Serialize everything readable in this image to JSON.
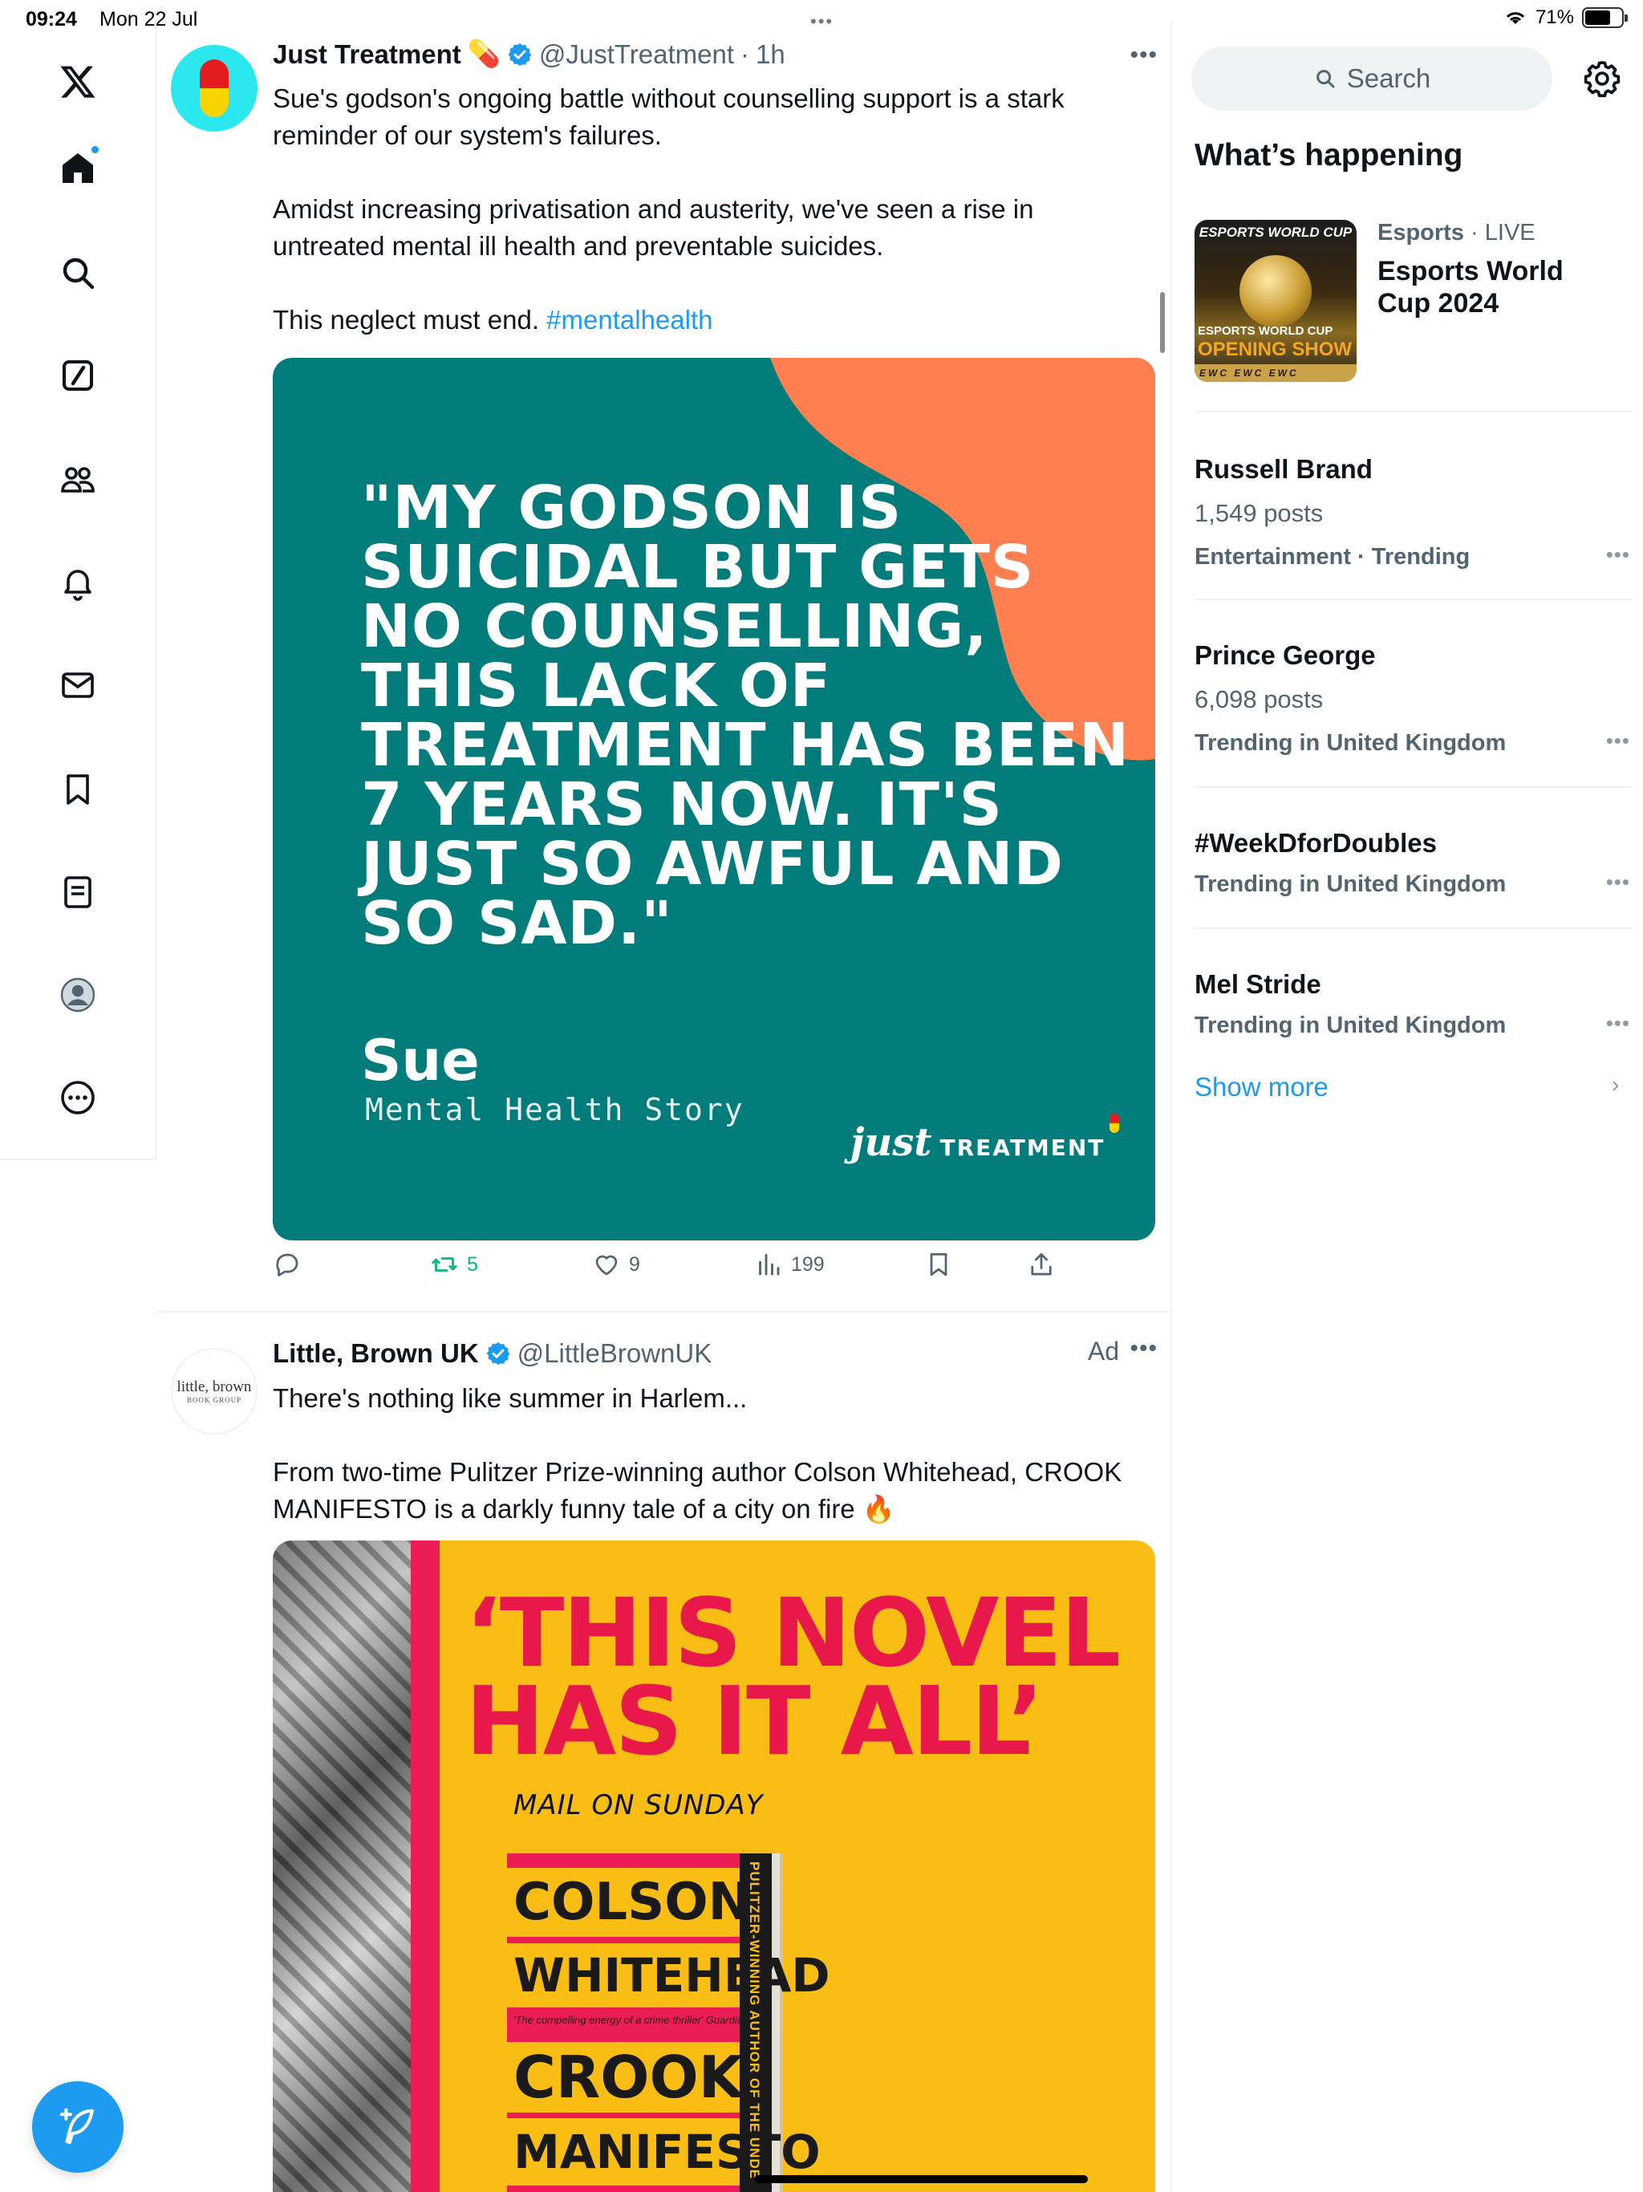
{
  "status_bar": {
    "time": "09:24",
    "date": "Mon 22 Jul",
    "battery": "71%",
    "battery_level": 0.71
  },
  "nav": {
    "items": [
      "home",
      "explore",
      "grok",
      "communities",
      "notifications",
      "messages",
      "bookmarks",
      "lists",
      "profile",
      "more"
    ],
    "has_notification_dot": true
  },
  "tweets": [
    {
      "name": "Just Treatment",
      "name_emoji": "💊",
      "handle": "@JustTreatment",
      "time": "1h",
      "body_1": "Sue's godson's ongoing battle without counselling support is a stark reminder of our system's failures.",
      "body_2": "Amidst increasing privatisation and austerity, we've seen a rise in untreated mental ill health and preventable suicides.",
      "body_3": "This neglect must end.",
      "hashtag": "#mentalhealth",
      "media": {
        "quote": "\"MY GODSON IS SUICIDAL BUT GETS NO COUNSELLING, THIS LACK OF TREATMENT HAS BEEN 7 YEARS NOW. IT'S JUST SO AWFUL AND SO SAD.\"",
        "person": "Sue",
        "caption": "Mental Health Story",
        "logo_just": "just",
        "logo_treatment": "TREATMENT"
      },
      "stats": {
        "replies": "",
        "reposts": "5",
        "likes": "9",
        "views": "199"
      }
    },
    {
      "name": "Little, Brown UK",
      "handle": "@LittleBrownUK",
      "ad_label": "Ad",
      "avatar_text_1": "little, brown",
      "avatar_text_2": "BOOK GROUP",
      "body_1": "There's nothing like summer in Harlem...",
      "body_2": "From two-time Pulitzer Prize-winning author Colson Whitehead, CROOK MANIFESTO is a darkly funny tale of a city on fire 🔥",
      "media": {
        "headline": "‘THIS NOVEL HAS IT ALL’",
        "source": "MAIL ON SUNDAY",
        "book_author_first": "COLSON",
        "book_author_last": "WHITEHEAD",
        "book_quote": "'The compelling energy of a crime thriller' Guardian",
        "book_title_1": "CROOK",
        "book_title_2": "MANIFESTO",
        "spine": "PULITZER-WINNING AUTHOR OF THE UNDE"
      }
    }
  ],
  "sidebar": {
    "search_placeholder": "Search",
    "section_title": "What’s happening",
    "featured": {
      "category": "Esports",
      "status": "LIVE",
      "title": "Esports World Cup 2024",
      "thumb_title": "ESPORTS WORLD CUP",
      "thumb_line1": "ESPORTS WORLD CUP",
      "thumb_line2": "OPENING SHOW",
      "thumb_bar": "EWC EWC EWC"
    },
    "trends": [
      {
        "name": "Russell Brand",
        "count": "1,549 posts",
        "context": "Entertainment · Trending"
      },
      {
        "name": "Prince George",
        "count": "6,098 posts",
        "context": "Trending in United Kingdom"
      },
      {
        "name": "#WeekDforDoubles",
        "count": "",
        "context": "Trending in United Kingdom"
      },
      {
        "name": "Mel Stride",
        "count": "",
        "context": "Trending in United Kingdom"
      }
    ],
    "show_more": "Show more"
  },
  "colors": {
    "accent": "#1d9bf0",
    "repost": "#00ba7c",
    "teal_card": "#017c7a",
    "orange_blob": "#ff7f50",
    "ad_yellow": "#f9bd13",
    "ad_red": "#e8184b"
  }
}
